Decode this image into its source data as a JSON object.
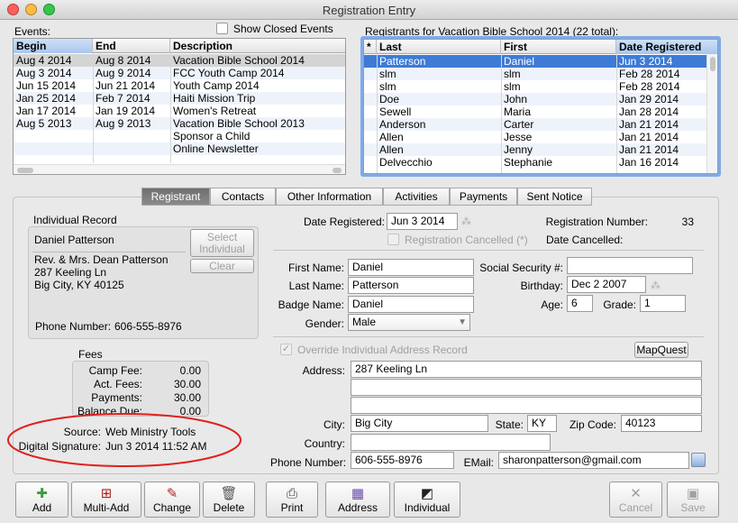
{
  "window": {
    "title": "Registration Entry"
  },
  "events": {
    "label": "Events:",
    "show_closed_label": "Show Closed Events",
    "columns": [
      "Begin",
      "End",
      "Description"
    ],
    "rows": [
      {
        "begin": "Aug 4 2014",
        "end": "Aug 8 2014",
        "description": "Vacation Bible School 2014"
      },
      {
        "begin": "Aug 3 2014",
        "end": "Aug 9 2014",
        "description": "FCC Youth Camp 2014"
      },
      {
        "begin": "Jun 15 2014",
        "end": "Jun 21 2014",
        "description": "Youth Camp 2014"
      },
      {
        "begin": "Jan 25 2014",
        "end": "Feb 7 2014",
        "description": "Haiti Mission Trip"
      },
      {
        "begin": "Jan 17 2014",
        "end": "Jan 19 2014",
        "description": "Women's Retreat"
      },
      {
        "begin": "Aug 5 2013",
        "end": "Aug 9 2013",
        "description": "Vacation Bible School 2013"
      },
      {
        "begin": "",
        "end": "",
        "description": "Sponsor a Child"
      },
      {
        "begin": "",
        "end": "",
        "description": "Online Newsletter"
      }
    ]
  },
  "registrants": {
    "label": "Registrants for Vacation Bible School 2014 (22 total):",
    "columns": [
      "*",
      "Last",
      "First",
      "Date Registered"
    ],
    "rows": [
      {
        "last": "Patterson",
        "first": "Daniel",
        "date": "Jun 3 2014"
      },
      {
        "last": "slm",
        "first": "slm",
        "date": "Feb 28 2014"
      },
      {
        "last": "slm",
        "first": "slm",
        "date": "Feb 28 2014"
      },
      {
        "last": "Doe",
        "first": "John",
        "date": "Jan 29 2014"
      },
      {
        "last": "Sewell",
        "first": "Maria",
        "date": "Jan 28 2014"
      },
      {
        "last": "Anderson",
        "first": "Carter",
        "date": "Jan 21 2014"
      },
      {
        "last": "Allen",
        "first": "Jesse",
        "date": "Jan 21 2014"
      },
      {
        "last": "Allen",
        "first": "Jenny",
        "date": "Jan 21 2014"
      },
      {
        "last": "Delvecchio",
        "first": "Stephanie",
        "date": "Jan 16 2014"
      }
    ]
  },
  "tabs": [
    "Registrant",
    "Contacts",
    "Other Information",
    "Activities",
    "Payments",
    "Sent Notice"
  ],
  "individual": {
    "label": "Individual Record",
    "name": "Daniel Patterson",
    "select_label": "Select Individual",
    "clear_label": "Clear",
    "address_line1": "Rev. & Mrs. Dean Patterson",
    "address_line2": "287 Keeling Ln",
    "address_line3": "Big City, KY  40125",
    "phone_label": "Phone Number:",
    "phone": "606-555-8976"
  },
  "fees": {
    "label": "Fees",
    "items": [
      {
        "label": "Camp Fee:",
        "value": "0.00"
      },
      {
        "label": "Act. Fees:",
        "value": "30.00"
      },
      {
        "label": "Payments:",
        "value": "30.00"
      },
      {
        "label": "Balance Due:",
        "value": "0.00"
      }
    ]
  },
  "source": {
    "source_label": "Source:",
    "source_value": "Web Ministry Tools",
    "signature_label": "Digital Signature:",
    "signature_value": "Jun 3 2014 11:52 AM"
  },
  "form": {
    "date_registered_label": "Date Registered:",
    "date_registered": "Jun 3 2014",
    "registration_number_label": "Registration Number:",
    "registration_number": "33",
    "cancelled_label": "Registration Cancelled (*)",
    "date_cancelled_label": "Date Cancelled:",
    "first_name_label": "First Name:",
    "first_name": "Daniel",
    "last_name_label": "Last Name:",
    "last_name": "Patterson",
    "badge_name_label": "Badge Name:",
    "badge_name": "Daniel",
    "gender_label": "Gender:",
    "gender": "Male",
    "ssn_label": "Social Security #:",
    "ssn": "",
    "birthday_label": "Birthday:",
    "birthday": "Dec 2 2007",
    "age_label": "Age:",
    "age": "6",
    "grade_label": "Grade:",
    "grade": "1",
    "override_label": "Override Individual Address Record",
    "mapquest_label": "MapQuest",
    "address_label": "Address:",
    "address1": "287 Keeling Ln",
    "address2": "",
    "address3": "",
    "city_label": "City:",
    "city": "Big City",
    "state_label": "State:",
    "state": "KY",
    "zip_label": "Zip Code:",
    "zip": "40123",
    "country_label": "Country:",
    "country": "",
    "phone_label": "Phone Number:",
    "phone": "606-555-8976",
    "email_label": "EMail:",
    "email": "sharonpatterson@gmail.com"
  },
  "toolbar": {
    "add": "Add",
    "multi_add": "Multi-Add",
    "change": "Change",
    "delete": "Delete",
    "print": "Print",
    "address": "Address",
    "individual": "Individual",
    "cancel": "Cancel",
    "save": "Save"
  },
  "colors": {
    "selection": "#3d7bd6",
    "annotation_circle": "#e0201c"
  }
}
